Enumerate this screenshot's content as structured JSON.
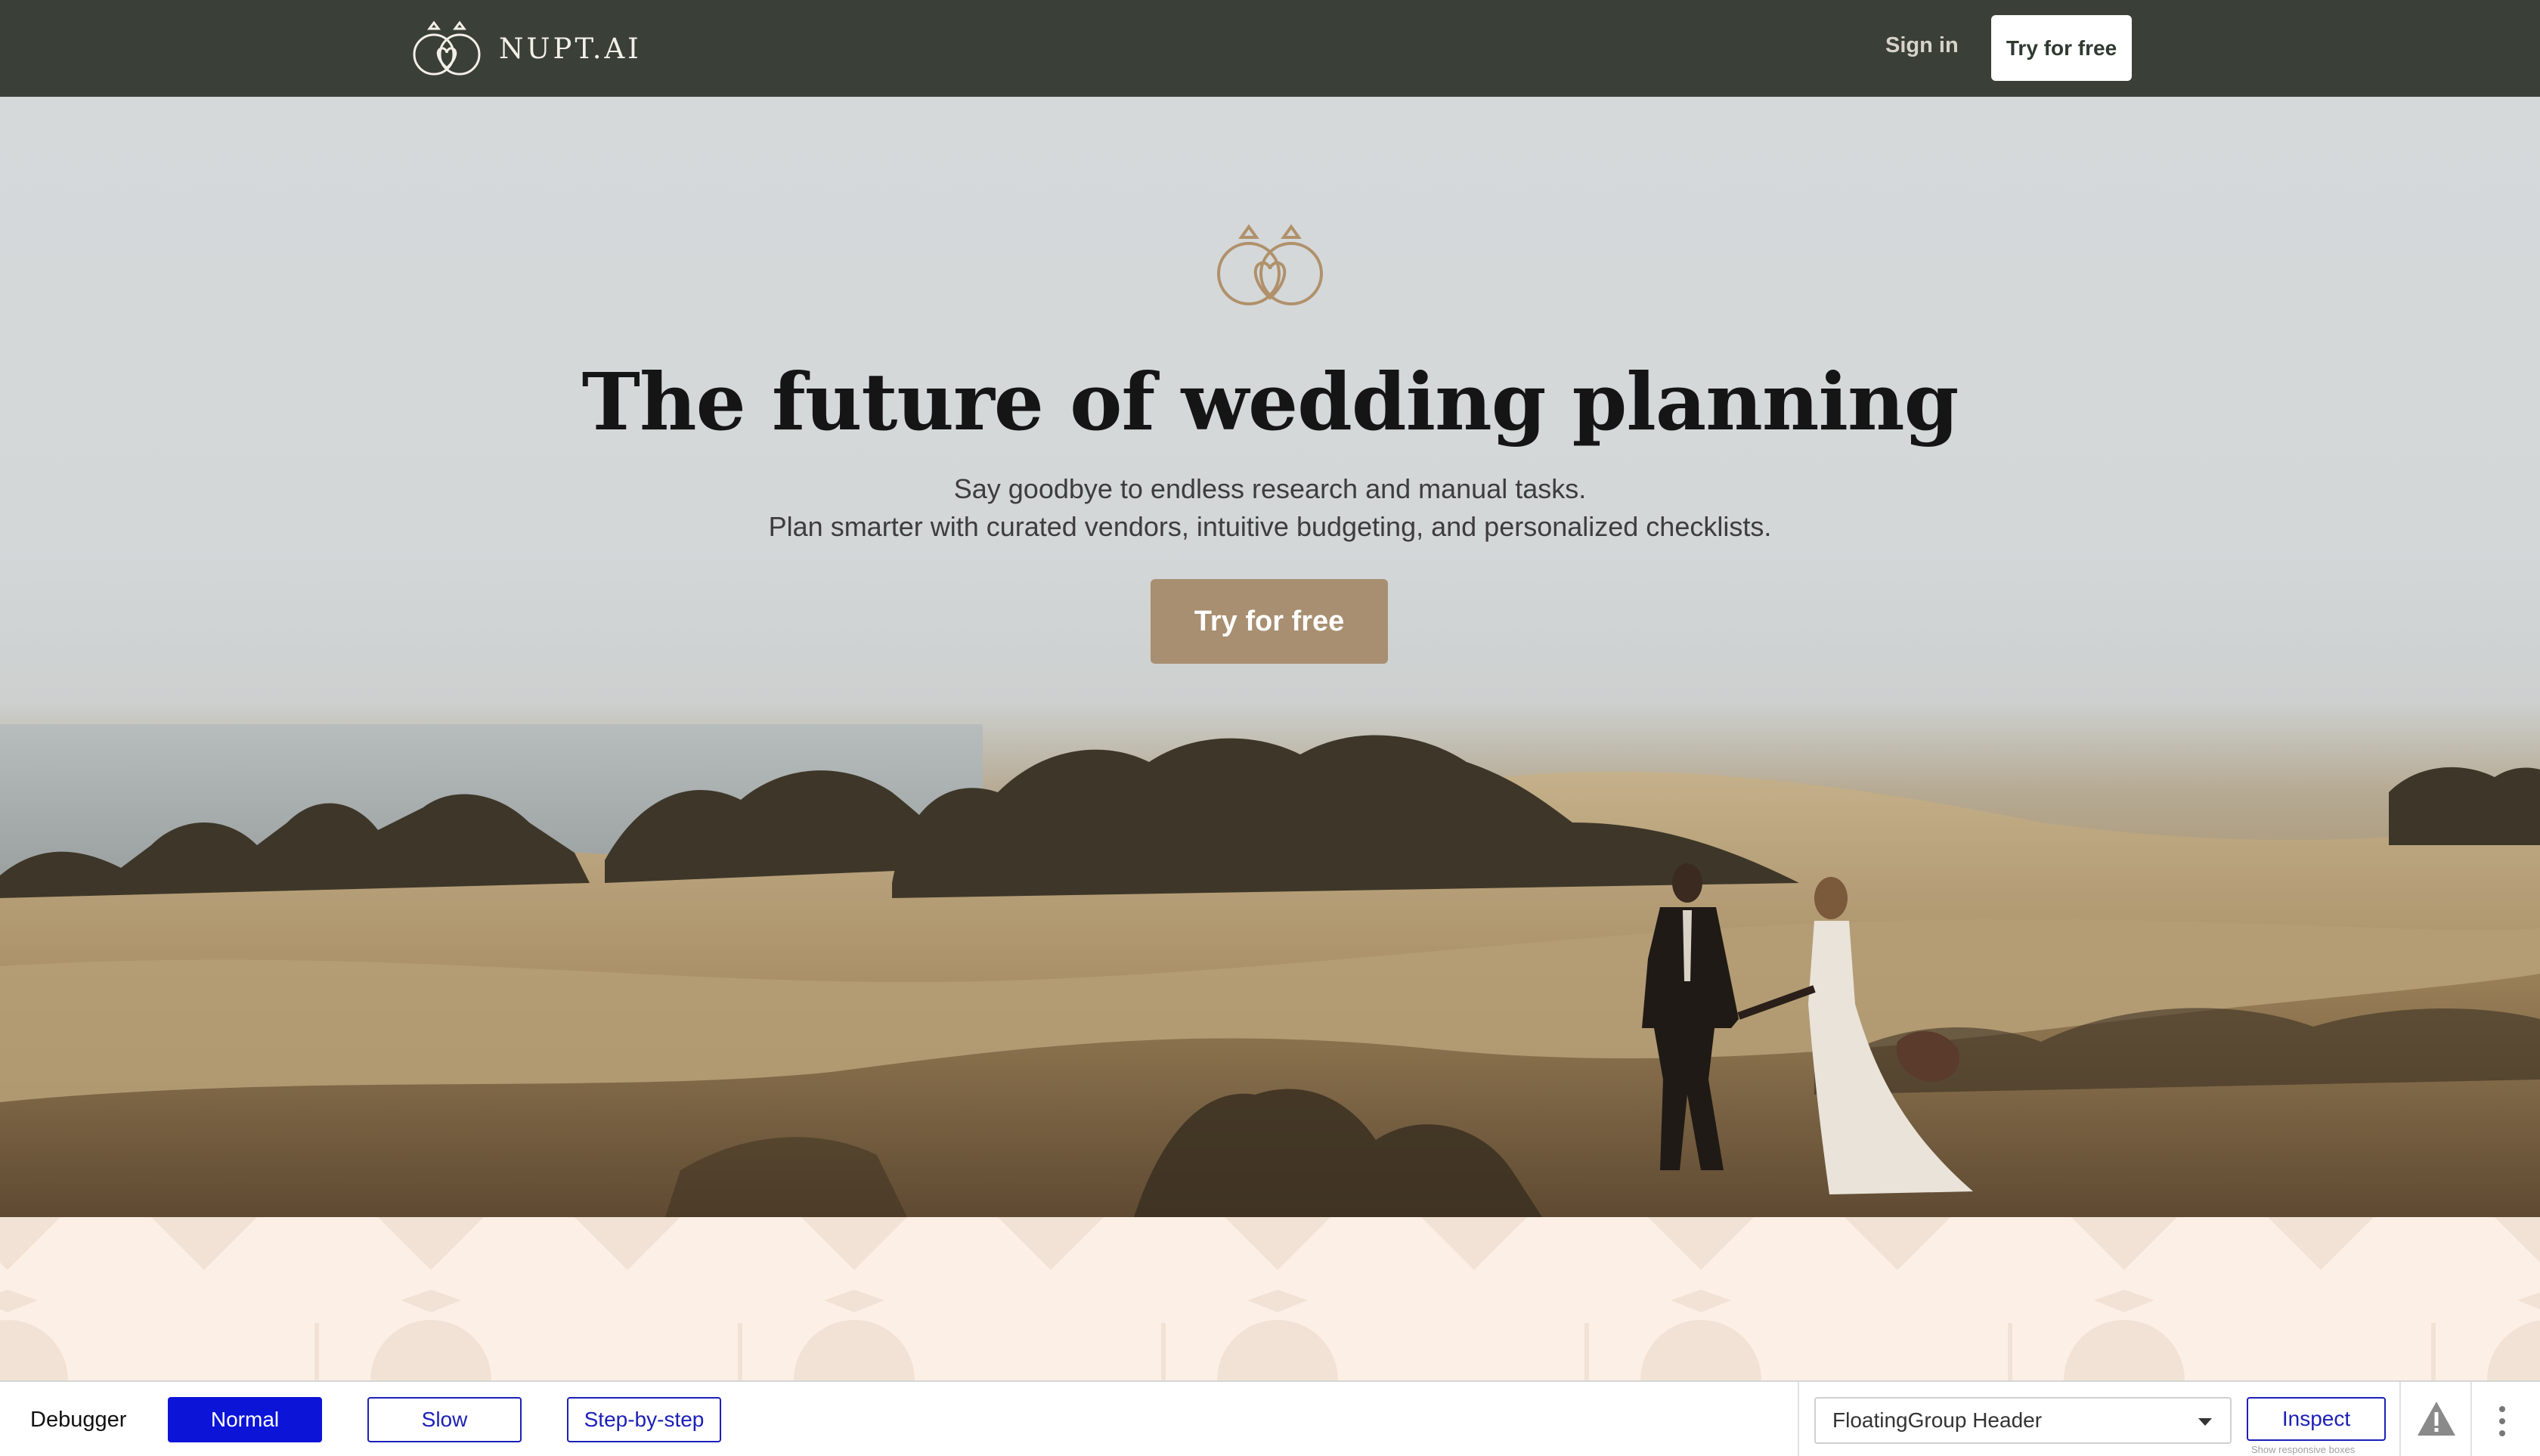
{
  "nav": {
    "brand": "NUPT.AI",
    "sign_in": "Sign in",
    "cta": "Try for free",
    "background": "#3a3f37"
  },
  "hero": {
    "title": "The future of wedding planning",
    "subtitle_line1": "Say goodbye to endless research and manual tasks.",
    "subtitle_line2": "Plan smarter with curated vendors, intuitive budgeting, and personalized checklists.",
    "cta": "Try for free",
    "accent": "#a88f71",
    "icon": "rings-heart-icon"
  },
  "pattern": {
    "color": "#fcefe6",
    "icon": "ring-pattern-icon"
  },
  "debugger": {
    "label": "Debugger",
    "modes": [
      "Normal",
      "Slow",
      "Step-by-step"
    ],
    "active_mode": "Normal",
    "selected_component": "FloatingGroup Header",
    "inspect_label": "Inspect",
    "hint": "Show responsive boxes",
    "accent": "#1c20b8"
  }
}
